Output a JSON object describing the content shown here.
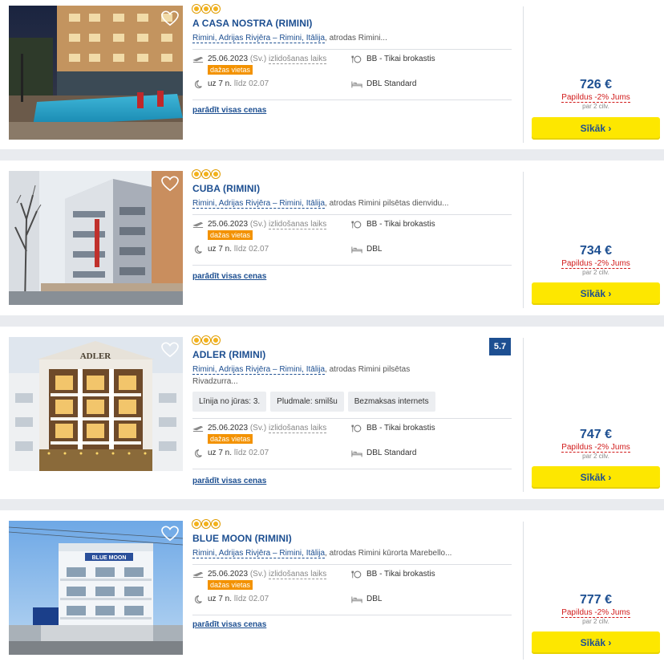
{
  "hotels": [
    {
      "name": "A CASA NOSTRA (RIMINI)",
      "location": "Rimini, Adrijas Rivjēra – Rimini, Itālija",
      "location_extra": ", atrodas Rimini...",
      "date": "25.06.2023",
      "day": "(Sv.)",
      "departure_label": "izlidošanas laiks",
      "badge": "dažas vietas",
      "duration": "uz 7 n.",
      "until": "līdz 02.07",
      "board": "BB - Tikai brokastis",
      "room": "DBL Standard",
      "all_prices": "parādīt visas cenas",
      "price": "726 €",
      "discount": "Papildus -2% Jums",
      "per": "par 2 cilv.",
      "button": "Sīkāk ›"
    },
    {
      "name": "CUBA (RIMINI)",
      "location": "Rimini, Adrijas Rivjēra – Rimini, Itālija",
      "location_extra": ", atrodas Rimini pilsētas dienvidu...",
      "date": "25.06.2023",
      "day": "(Sv.)",
      "departure_label": "izlidošanas laiks",
      "badge": "dažas vietas",
      "duration": "uz 7 n.",
      "until": "līdz 02.07",
      "board": "BB - Tikai brokastis",
      "room": "DBL",
      "all_prices": "parādīt visas cenas",
      "price": "734 €",
      "discount": "Papildus -2% Jums",
      "per": "par 2 cilv.",
      "button": "Sīkāk ›"
    },
    {
      "name": "ADLER (RIMINI)",
      "rating": "5.7",
      "location": "Rimini, Adrijas Rivjēra – Rimini, Itālija",
      "location_extra": ", atrodas Rimini pilsētas Rivadzurra...",
      "tags": [
        "Līnija no jūras: 3.",
        "Pludmale: smilšu",
        "Bezmaksas internets"
      ],
      "date": "25.06.2023",
      "day": "(Sv.)",
      "departure_label": "izlidošanas laiks",
      "badge": "dažas vietas",
      "duration": "uz 7 n.",
      "until": "līdz 02.07",
      "board": "BB - Tikai brokastis",
      "room": "DBL Standard",
      "all_prices": "parādīt visas cenas",
      "price": "747 €",
      "discount": "Papildus -2% Jums",
      "per": "par 2 cilv.",
      "button": "Sīkāk ›"
    },
    {
      "name": "BLUE MOON (RIMINI)",
      "location": "Rimini, Adrijas Rivjēra – Rimini, Itālija",
      "location_extra": ", atrodas Rimini kūrorta Marebello...",
      "date": "25.06.2023",
      "day": "(Sv.)",
      "departure_label": "izlidošanas laiks",
      "badge": "dažas vietas",
      "duration": "uz 7 n.",
      "until": "līdz 02.07",
      "board": "BB - Tikai brokastis",
      "room": "DBL",
      "all_prices": "parādīt visas cenas",
      "price": "777 €",
      "discount": "Papildus -2% Jums",
      "per": "par 2 cilv.",
      "button": "Sīkāk ›"
    }
  ],
  "photo_signage": {
    "adler": "ADLER",
    "blue_moon": "BLUE MOON"
  },
  "icons": [
    "heart-icon",
    "plane-icon",
    "moon-icon",
    "meal-icon",
    "bed-icon",
    "star-icon"
  ],
  "colors": {
    "accent": "#1d4f91",
    "button": "#fde700",
    "badge": "#f39200",
    "discount": "#d11b1b",
    "star": "#f3b21b"
  }
}
